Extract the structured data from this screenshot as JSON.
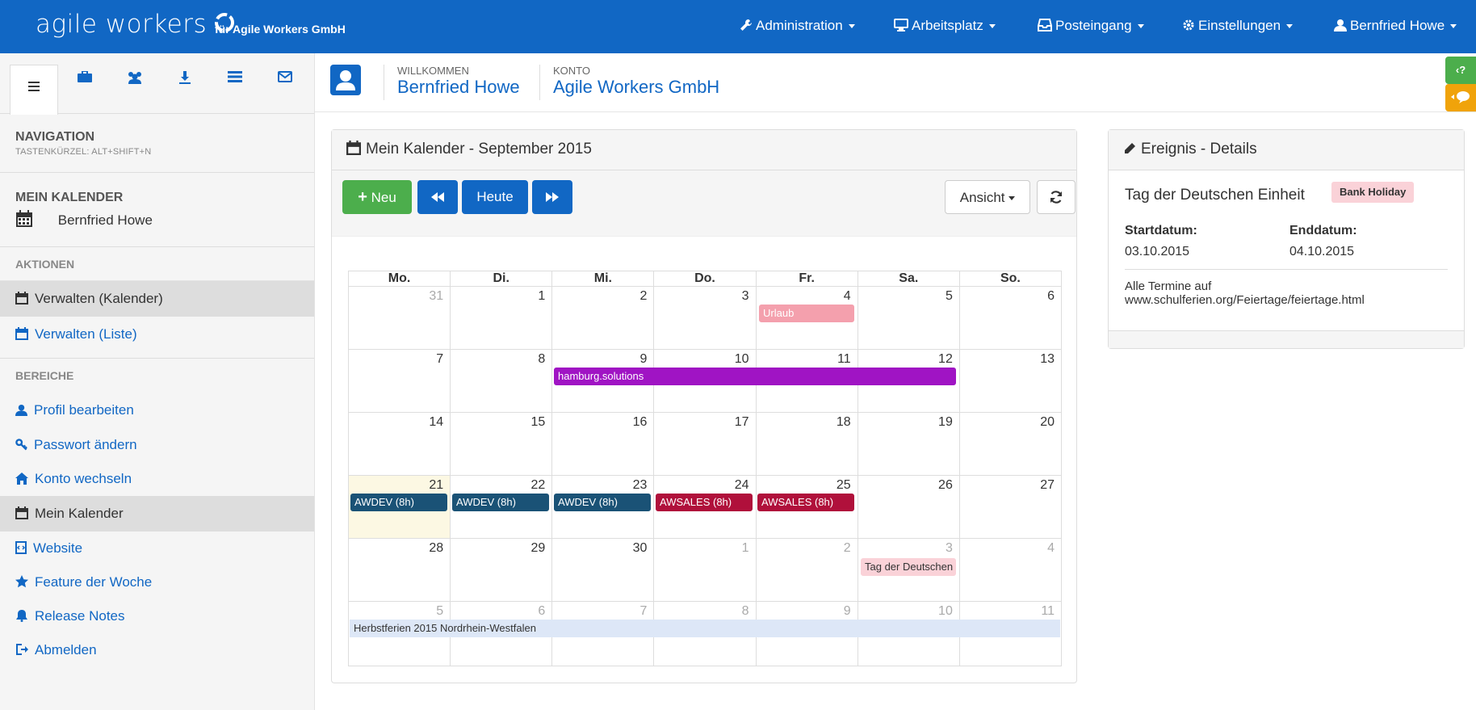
{
  "topbar": {
    "brand": "agile workers",
    "subtitle": "für Agile Workers GmbH",
    "nav": [
      "Administration",
      "Arbeitsplatz",
      "Posteingang",
      "Einstellungen",
      "Bernfried Howe"
    ]
  },
  "sidebar": {
    "nav_title": "NAVIGATION",
    "nav_sub": "TASTENKÜRZEL: ALT+SHIFT+N",
    "calendar_title": "MEIN KALENDER",
    "calendar_user": "Bernfried Howe",
    "actions_head": "AKTIONEN",
    "actions": [
      "Verwalten (Kalender)",
      "Verwalten (Liste)"
    ],
    "areas_head": "BEREICHE",
    "areas": [
      "Profil bearbeiten",
      "Passwort ändern",
      "Konto wechseln",
      "Mein Kalender",
      "Website",
      "Feature der Woche",
      "Release Notes",
      "Abmelden"
    ]
  },
  "header": {
    "welcome_label": "WILLKOMMEN",
    "welcome_value": "Bernfried Howe",
    "account_label": "KONTO",
    "account_value": "Agile Workers GmbH"
  },
  "calendar": {
    "title": "Mein Kalender - September 2015",
    "btn_new": "Neu",
    "btn_today": "Heute",
    "btn_view": "Ansicht",
    "weekdays": [
      "Mo.",
      "Di.",
      "Mi.",
      "Do.",
      "Fr.",
      "Sa.",
      "So."
    ],
    "weeks": [
      [
        "31",
        "1",
        "2",
        "3",
        "4",
        "5",
        "6"
      ],
      [
        "7",
        "8",
        "9",
        "10",
        "11",
        "12",
        "13"
      ],
      [
        "14",
        "15",
        "16",
        "17",
        "18",
        "19",
        "20"
      ],
      [
        "21",
        "22",
        "23",
        "24",
        "25",
        "26",
        "27"
      ],
      [
        "28",
        "29",
        "30",
        "1",
        "2",
        "3",
        "4"
      ],
      [
        "5",
        "6",
        "7",
        "8",
        "9",
        "10",
        "11"
      ]
    ],
    "events": [
      {
        "title": "Urlaub",
        "color": "#f4a0ad",
        "text": "#fff"
      },
      {
        "title": "hamburg.solutions",
        "color": "#a014c4",
        "text": "#fff"
      },
      {
        "title": "AWDEV (8h)",
        "color": "#1a5276",
        "text": "#fff"
      },
      {
        "title": "AWDEV (8h)",
        "color": "#1a5276",
        "text": "#fff"
      },
      {
        "title": "AWDEV (8h)",
        "color": "#1a5276",
        "text": "#fff"
      },
      {
        "title": "AWSALES (8h)",
        "color": "#b0103b",
        "text": "#fff"
      },
      {
        "title": "AWSALES (8h)",
        "color": "#b0103b",
        "text": "#fff"
      },
      {
        "title": "Tag der Deutschen Einheit",
        "color": "#fad2d8",
        "text": "#333"
      },
      {
        "title": "Herbstferien 2015 Nordrhein-Westfalen",
        "color": "#dde7f7",
        "text": "#333"
      }
    ]
  },
  "details": {
    "title": "Ereignis - Details",
    "event_name": "Tag der Deutschen Einheit",
    "badge": "Bank Holiday",
    "start_label": "Startdatum:",
    "start_value": "03.10.2015",
    "end_label": "Enddatum:",
    "end_value": "04.10.2015",
    "note_line1": "Alle Termine auf",
    "note_line2": "www.schulferien.org/Feiertage/feiertage.html"
  },
  "colors": {
    "primary": "#1167c4",
    "success": "#4cae4c",
    "help_tab": "#4cae4c",
    "chat_tab": "#f0a30a"
  }
}
